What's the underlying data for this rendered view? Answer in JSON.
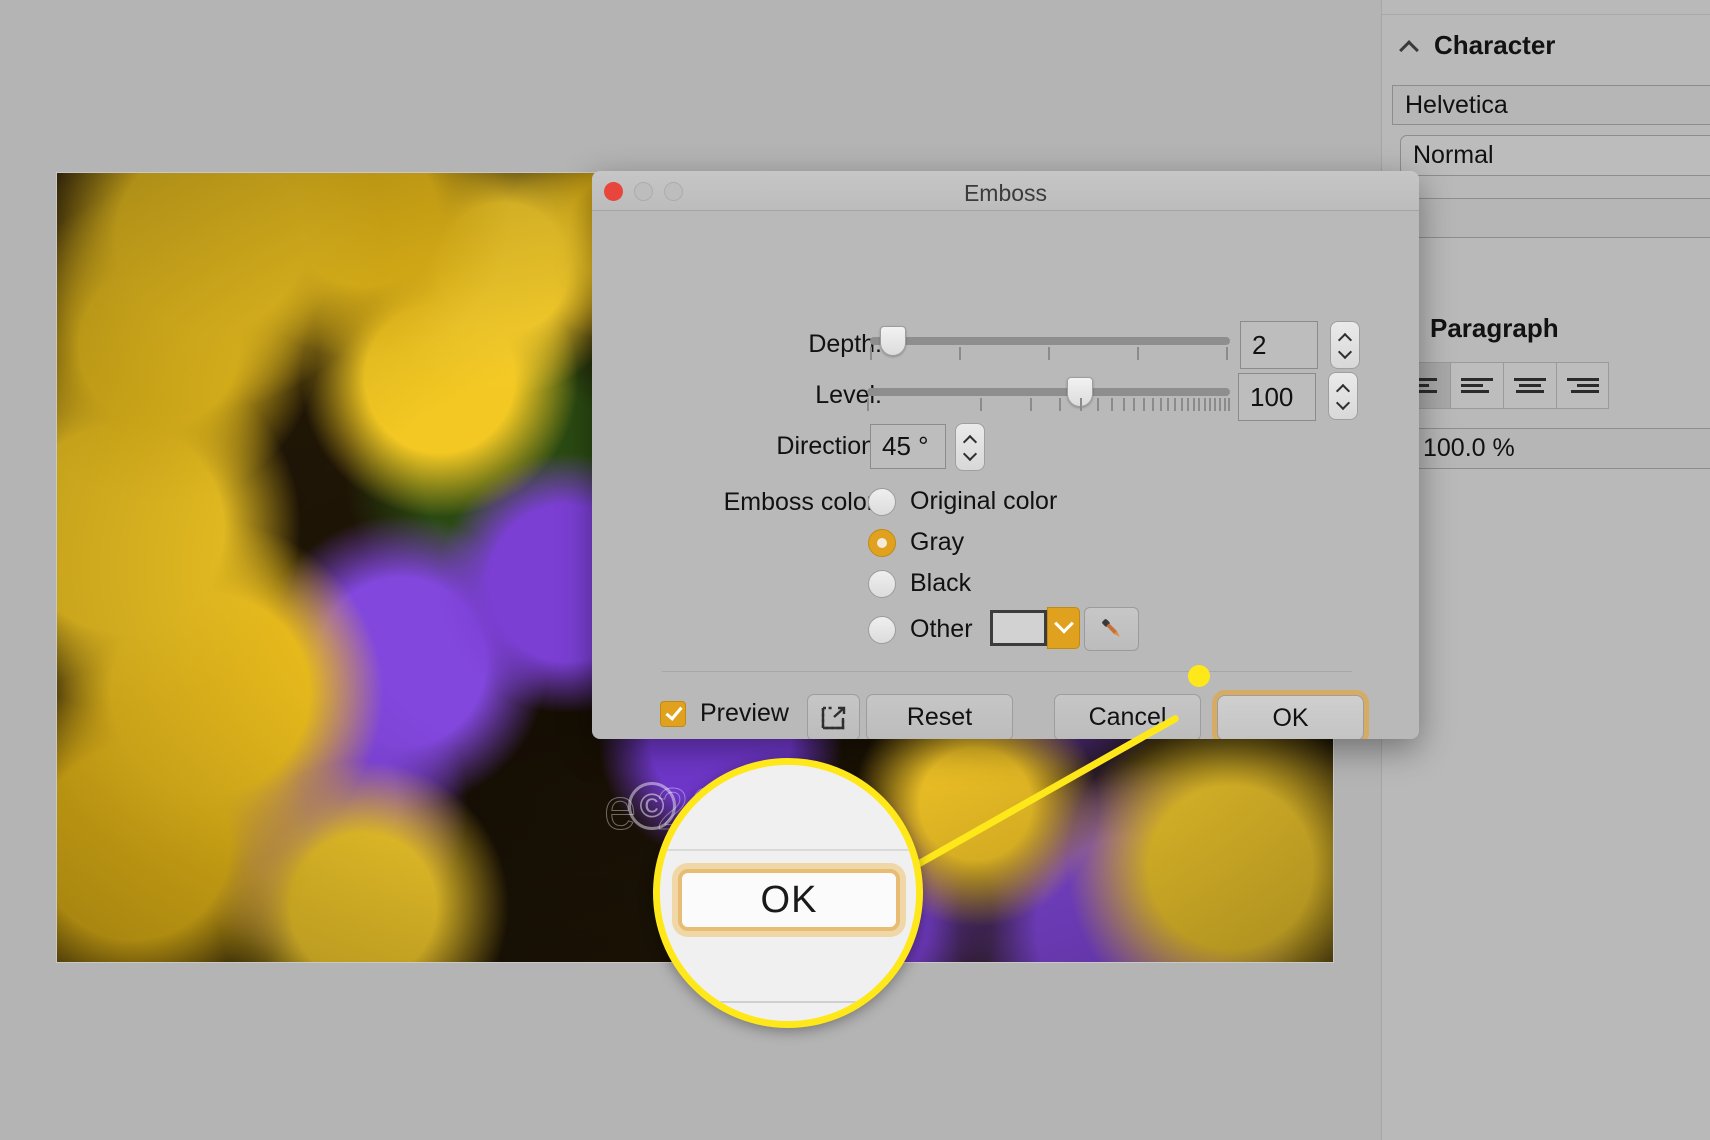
{
  "app": {
    "background_color": "#b4b4b4"
  },
  "canvas": {
    "watermark_text": "e 2020",
    "copyright_glyph": "©"
  },
  "right_panel": {
    "character": {
      "title": "Character",
      "collapse_icon": "chevron-up-icon",
      "font_family": "Helvetica",
      "font_style": "Normal"
    },
    "paragraph": {
      "title": "Paragraph",
      "align_buttons": [
        {
          "name": "align-justify-last-left",
          "active": true
        },
        {
          "name": "align-left",
          "active": false
        },
        {
          "name": "align-center",
          "active": false
        },
        {
          "name": "align-right",
          "active": false
        }
      ],
      "scale_value": "100.0 %"
    }
  },
  "dialog": {
    "title": "Emboss",
    "window_controls": {
      "close": "close-button",
      "minimize": "minimize-button",
      "zoom": "zoom-button"
    },
    "depth": {
      "label": "Depth:",
      "value": "2",
      "min": 1,
      "max": 10,
      "knob_percent": 6
    },
    "level": {
      "label": "Level:",
      "value": "100",
      "min": 1,
      "max": 1000,
      "knob_percent": 60
    },
    "direction": {
      "label": "Direction:",
      "value": "45 °"
    },
    "emboss_color": {
      "label": "Emboss color:",
      "options": [
        {
          "label": "Original color",
          "selected": false
        },
        {
          "label": "Gray",
          "selected": true
        },
        {
          "label": "Black",
          "selected": false
        },
        {
          "label": "Other",
          "selected": false
        }
      ],
      "swatch_color": "#d2d2d2",
      "dropdown_icon": "chevron-down-icon",
      "eyedropper_icon": "eyedropper-icon"
    },
    "footer": {
      "preview_label": "Preview",
      "preview_checked": true,
      "export_icon": "export-to-new-window-icon",
      "reset_label": "Reset",
      "cancel_label": "Cancel",
      "ok_label": "OK"
    }
  },
  "callout": {
    "magnified_label": "OK",
    "highlight_color": "#ffe81a",
    "accent_color": "#e0a21e",
    "default_button_ring": "#d6ab63"
  }
}
